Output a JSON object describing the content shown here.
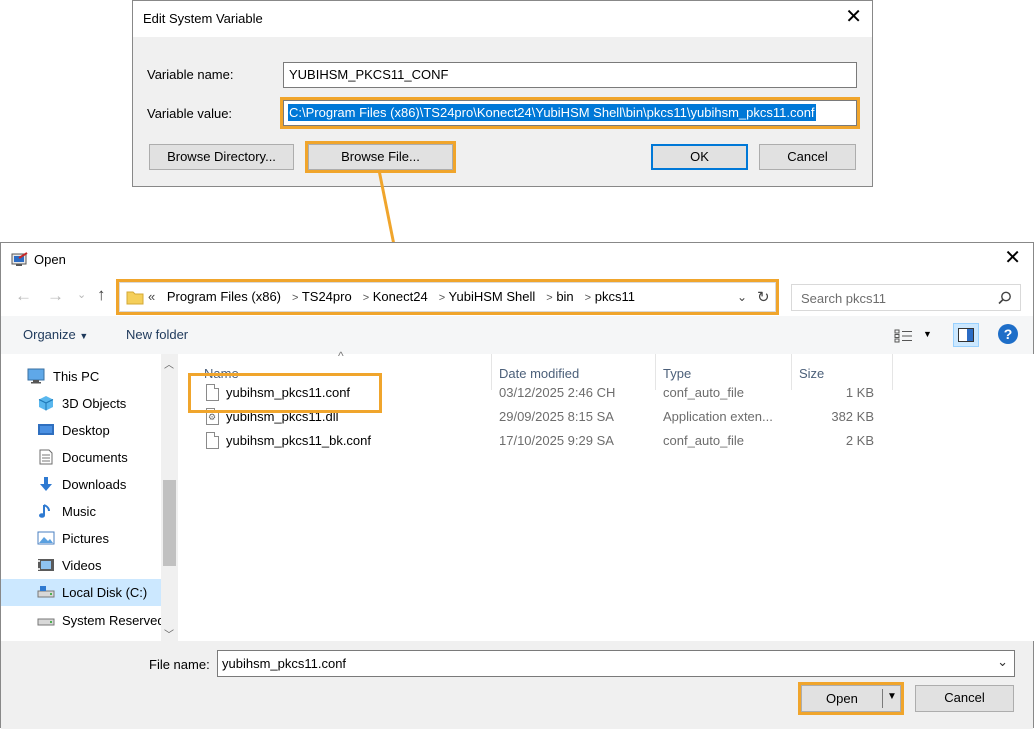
{
  "edit_dialog": {
    "title": "Edit System Variable",
    "var_name_label": "Variable name:",
    "var_name_value": "YUBIHSM_PKCS11_CONF",
    "var_value_label": "Variable value:",
    "var_value_value": "C:\\Program Files (x86)\\TS24pro\\Konect24\\YubiHSM Shell\\bin\\pkcs11\\yubihsm_pkcs11.conf",
    "browse_directory": "Browse Directory...",
    "browse_file": "Browse File...",
    "ok": "OK",
    "cancel": "Cancel",
    "close_glyph": "✕"
  },
  "open_dialog": {
    "title": "Open",
    "close_glyph": "✕",
    "breadcrumbs_prefix": "«",
    "breadcrumbs": [
      "Program Files (x86)",
      "TS24pro",
      "Konect24",
      "YubiHSM Shell",
      "bin",
      "pkcs11"
    ],
    "search_placeholder": "Search pkcs11",
    "toolbar": {
      "organize": "Organize",
      "new_folder": "New folder"
    },
    "nav_items": [
      {
        "label": "This PC",
        "icon": "monitor-icon"
      },
      {
        "label": "3D Objects",
        "icon": "cube-icon"
      },
      {
        "label": "Desktop",
        "icon": "desktop-icon"
      },
      {
        "label": "Documents",
        "icon": "document-icon"
      },
      {
        "label": "Downloads",
        "icon": "download-icon"
      },
      {
        "label": "Music",
        "icon": "music-icon"
      },
      {
        "label": "Pictures",
        "icon": "picture-icon"
      },
      {
        "label": "Videos",
        "icon": "video-icon"
      },
      {
        "label": "Local Disk (C:)",
        "icon": "disk-icon",
        "selected": true
      },
      {
        "label": "System Reserved",
        "icon": "drive-icon"
      }
    ],
    "columns": [
      "Name",
      "Date modified",
      "Type",
      "Size"
    ],
    "files": [
      {
        "name": "yubihsm_pkcs11.conf",
        "date": "03/12/2025 2:46 CH",
        "type": "conf_auto_file",
        "size": "1 KB"
      },
      {
        "name": "yubihsm_pkcs11.dll",
        "date": "29/09/2025 8:15 SA",
        "type": "Application exten...",
        "size": "382 KB"
      },
      {
        "name": "yubihsm_pkcs11_bk.conf",
        "date": "17/10/2025 9:29 SA",
        "type": "conf_auto_file",
        "size": "2 KB"
      }
    ],
    "file_name_label": "File name:",
    "file_name_value": "yubihsm_pkcs11.conf",
    "open": "Open",
    "cancel": "Cancel"
  },
  "colors": {
    "highlight": "#f0a52c",
    "selection": "#0078d7",
    "nav_selected": "#cce8ff",
    "help": "#1e6ec8"
  }
}
